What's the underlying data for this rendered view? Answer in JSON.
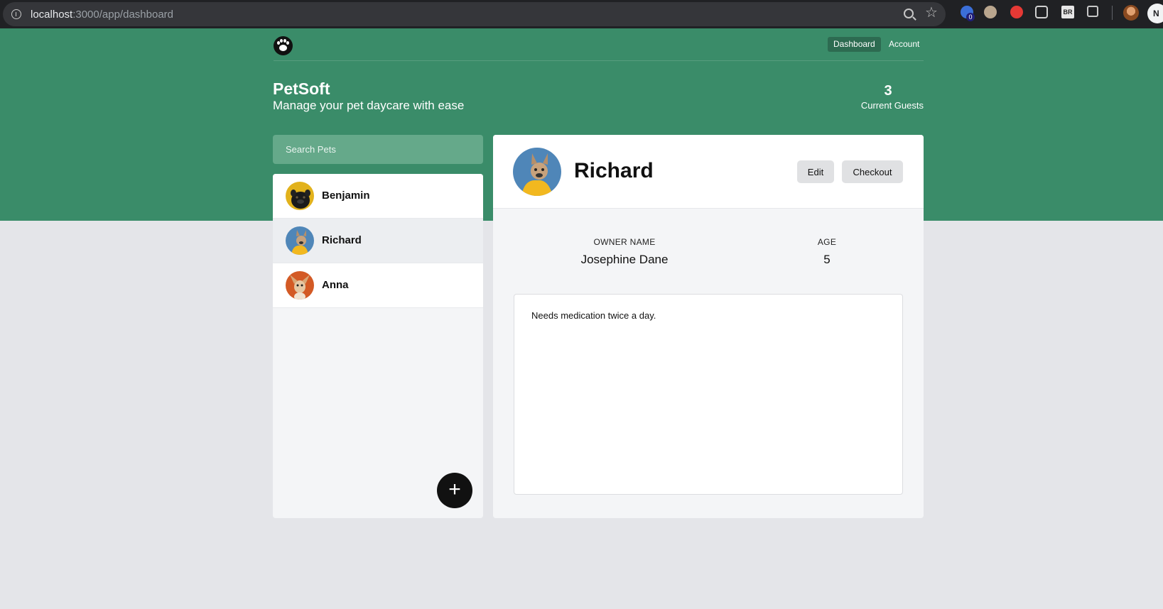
{
  "browser": {
    "url_host": "localhost",
    "url_path": ":3000/app/dashboard",
    "extension_badge": "0",
    "extension_label": "BR",
    "profile_initial": "N"
  },
  "header": {
    "nav": [
      {
        "label": "Dashboard",
        "active": true
      },
      {
        "label": "Account",
        "active": false
      }
    ],
    "title": "PetSoft",
    "subtitle": "Manage your pet daycare with ease",
    "guest_count": "3",
    "guest_label": "Current Guests"
  },
  "search": {
    "placeholder": "Search Pets"
  },
  "pets": [
    {
      "name": "Benjamin",
      "avatar": "black-pug"
    },
    {
      "name": "Richard",
      "avatar": "french-bulldog-yellow-hoodie",
      "selected": true
    },
    {
      "name": "Anna",
      "avatar": "chihuahua"
    }
  ],
  "add_button": {
    "label": "+"
  },
  "detail": {
    "name": "Richard",
    "edit_label": "Edit",
    "checkout_label": "Checkout",
    "owner_label": "OWNER NAME",
    "owner_value": "Josephine Dane",
    "age_label": "AGE",
    "age_value": "5",
    "notes": "Needs medication twice a day."
  },
  "colors": {
    "brand_green": "#3a8c69",
    "page_bg": "#e4e5e9"
  }
}
